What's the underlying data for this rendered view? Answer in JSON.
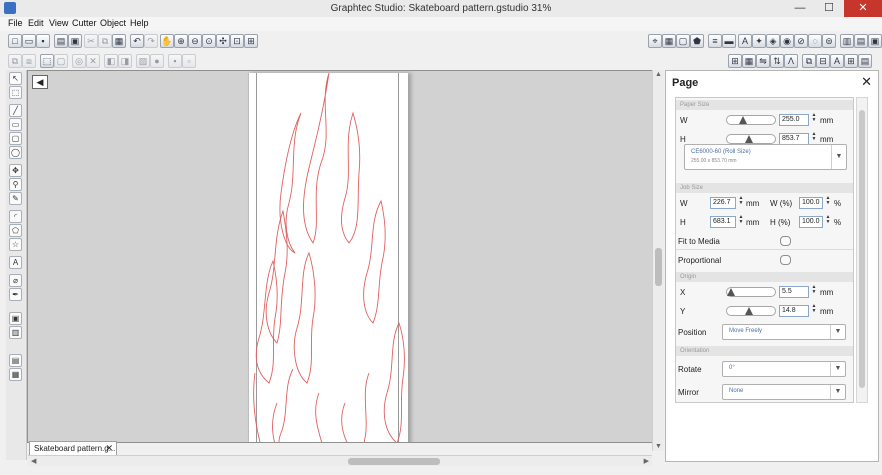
{
  "window": {
    "title": "Graphtec Studio: Skateboard pattern.gstudio 31%",
    "minimize": "—",
    "maximize": "☐",
    "close": "✕"
  },
  "menu": [
    "File",
    "Edit",
    "View",
    "Cutter",
    "Object",
    "Help"
  ],
  "canvas": {
    "tab_label": "Skateboard pattern.g...",
    "tab_close": "✕",
    "corner_glyph": "◀"
  },
  "panel": {
    "title": "Page",
    "close": "✕",
    "paper_size": {
      "header": "Paper Size",
      "w_label": "W",
      "w_value": "255.0",
      "w_unit": "mm",
      "w_slider": 0.5,
      "h_label": "H",
      "h_value": "853.7",
      "h_unit": "mm",
      "h_slider": 0.5,
      "media_name": "CE6000-60 (Roll Size)",
      "media_size": "255.00 x 853.70 mm"
    },
    "job_size": {
      "header": "Job Size",
      "w_label": "W",
      "w_value": "226.7",
      "w_unit": "mm",
      "wp_label": "W (%)",
      "wp_value": "100.0",
      "wp_unit": "%",
      "h_label": "H",
      "h_value": "683.1",
      "h_unit": "mm",
      "hp_label": "H (%)",
      "hp_value": "100.0",
      "hp_unit": "%",
      "fit_label": "Fit to Media",
      "proportional_label": "Proportional"
    },
    "origin": {
      "header": "Origin",
      "x_label": "X",
      "x_value": "5.5",
      "x_unit": "mm",
      "x_slider": 0.03,
      "y_label": "Y",
      "y_value": "14.8",
      "y_unit": "mm",
      "y_slider": 0.45,
      "position_label": "Position",
      "position_value": "Move Freely"
    },
    "orientation": {
      "header": "Orientation",
      "rotate_label": "Rotate",
      "rotate_value": "0°",
      "mirror_label": "Mirror",
      "mirror_value": "None"
    }
  },
  "colors": {
    "flame_stroke": "#e06060",
    "accent": "#4a6fa5"
  },
  "icons": {
    "caret": "▼",
    "spin_up": "▲",
    "spin_down": "▼"
  }
}
